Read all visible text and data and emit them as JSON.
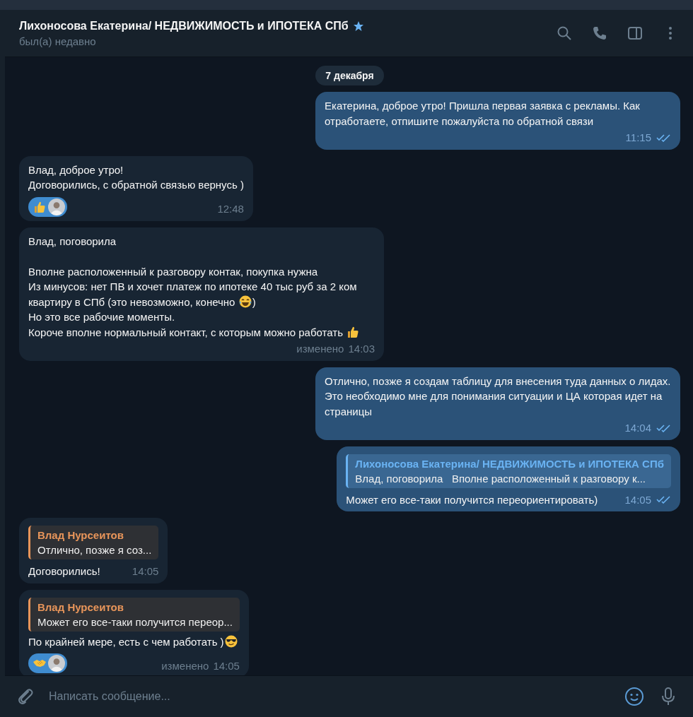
{
  "header": {
    "title": "Лихоносова Екатерина/ НЕДВИЖИМОСТЬ и ИПОТЕКА СПб",
    "verified": true,
    "status": "был(а) недавно"
  },
  "date_badge": "7 декабря",
  "messages": [
    {
      "kind": "outgoing",
      "body": [
        {
          "kind": "text",
          "text": "Екатерина, доброе утро! Пришла первая заявка с рекламы. Как отработаете, отпишите пожалуйста по обратной связи"
        }
      ],
      "time": "11:15",
      "read": true
    },
    {
      "kind": "incoming",
      "body": [
        {
          "kind": "text",
          "text": "Влад, доброе утро!\nДоговорились, с обратной связью вернусь )"
        }
      ],
      "reactions": [
        {
          "kind": "thumbsup"
        }
      ],
      "time": "12:48"
    },
    {
      "kind": "incoming",
      "body": [
        {
          "kind": "text",
          "text": "Влад, поговорила\n\nВполне расположенный к разговору контак, покупка нужна\nИз минусов: нет ПВ и хочет платеж по ипотеке 40 тыс руб за 2 ком квартиру в СПб (это невозможно, конечно "
        },
        {
          "kind": "laughing"
        },
        {
          "kind": "text",
          "text": ")\nНо это все рабочие моменты.\nКороче вполне нормальный контакт, с которым можно работать "
        },
        {
          "kind": "thumbsup"
        }
      ],
      "edited": "изменено",
      "time": "14:03"
    },
    {
      "kind": "outgoing",
      "body": [
        {
          "kind": "text",
          "text": "Отлично, позже я создам таблицу для внесения туда данных о лидах. Это необходимо мне для понимания ситуации и ЦА которая идет на страницы"
        }
      ],
      "time": "14:04",
      "read": true
    },
    {
      "kind": "outgoing",
      "reply": {
        "author": "Лихоносова Екатерина/ НЕДВИЖИМОСТЬ и ИПОТЕКА СПб",
        "text": "Влад, поговорила   Вполне расположенный к разговору к...",
        "color": "#6ab3f3"
      },
      "body": [
        {
          "kind": "text",
          "text": "Может его все-таки получится переориентировать)"
        }
      ],
      "time": "14:05",
      "read": true
    },
    {
      "kind": "incoming",
      "reply": {
        "author": "Влад Нурсеитов",
        "text": "Отлично, позже я соз...",
        "color": "#e8955a"
      },
      "body": [
        {
          "kind": "text",
          "text": "Договорились!"
        }
      ],
      "time": "14:05"
    },
    {
      "kind": "incoming",
      "reply": {
        "author": "Влад Нурсеитов",
        "text": "Может его все-таки получится переор...",
        "color": "#e8955a"
      },
      "body": [
        {
          "kind": "text",
          "text": "По крайней мере, есть с чем работать )"
        },
        {
          "kind": "sunglasses"
        }
      ],
      "reactions": [
        {
          "kind": "handshake"
        }
      ],
      "edited": "изменено",
      "time": "14:05"
    }
  ],
  "composer": {
    "placeholder": "Написать сообщение..."
  }
}
